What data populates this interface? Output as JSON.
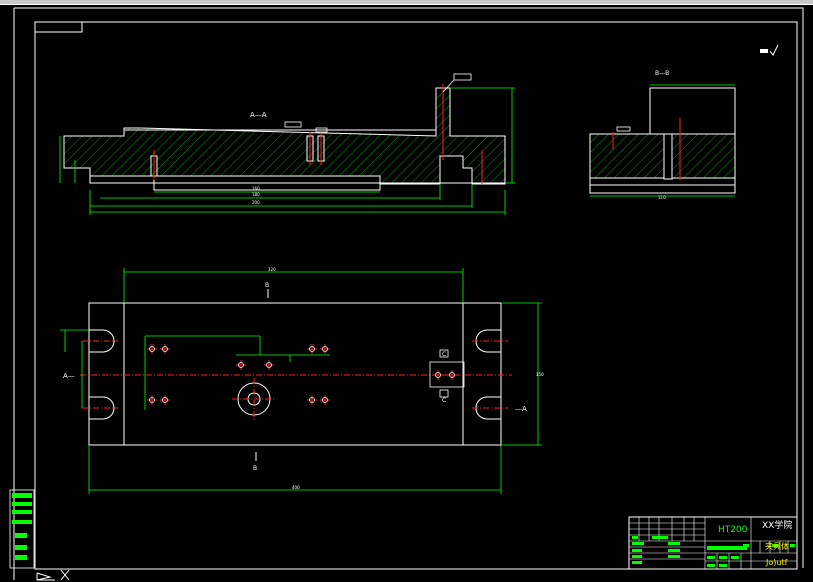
{
  "section_aa": {
    "label": "A—A",
    "dimensions": [
      "160",
      "180",
      "200"
    ]
  },
  "section_bb": {
    "label": "B—B",
    "dimensions": [
      "110"
    ]
  },
  "plan_view": {
    "section_mark_a_left": "A—",
    "section_mark_a_right": "—A",
    "section_mark_b_top": "B",
    "section_mark_b_bottom": "B",
    "dim_top": "320",
    "dim_bottom": "400",
    "dim_right": "150",
    "hole_label_c_top": "C",
    "hole_label_c_bottom": "C"
  },
  "title_block": {
    "material": "HT200",
    "school": "XX学院",
    "drawing_name": "夹具体",
    "designer": "Jo)utf"
  },
  "colors": {
    "background": "#000000",
    "line": "#ffffff",
    "dimension": "#00ff00",
    "hatch": "#00ff00",
    "center_line": "#ff0000",
    "text": "#ffffff"
  }
}
